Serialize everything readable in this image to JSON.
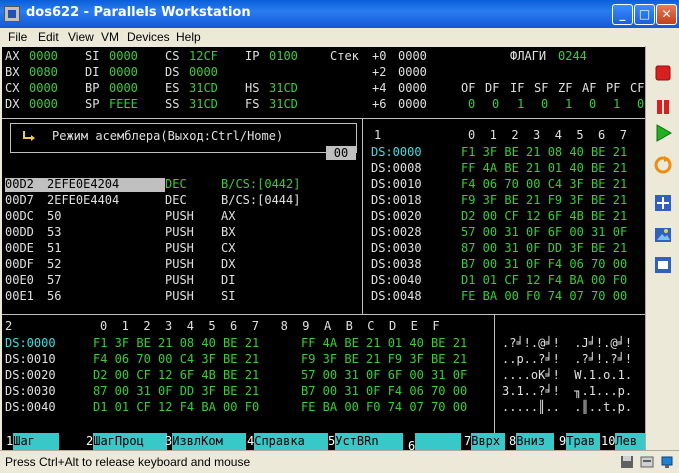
{
  "window": {
    "title": "dos622 - Parallels Workstation",
    "minimize": "_",
    "maximize": "□",
    "close": "✕"
  },
  "menu": [
    "File",
    "Edit",
    "View",
    "VM",
    "Devices",
    "Help"
  ],
  "registers": [
    [
      "AX",
      "0000",
      "SI",
      "0000",
      "CS",
      "12CF",
      "IP",
      "0100"
    ],
    [
      "BX",
      "0080",
      "DI",
      "0000",
      "DS",
      "0000",
      "",
      ""
    ],
    [
      "CX",
      "0000",
      "BP",
      "0000",
      "ES",
      "31CD",
      "HS",
      "31CD"
    ],
    [
      "DX",
      "0000",
      "SP",
      "FEEE",
      "SS",
      "31CD",
      "FS",
      "31CD"
    ]
  ],
  "stack": {
    "label": "Стек",
    "rows": [
      [
        "+0",
        "0000"
      ],
      [
        "+2",
        "0000"
      ],
      [
        "+4",
        "0000"
      ],
      [
        "+6",
        "0000"
      ]
    ]
  },
  "flags": {
    "label": "ФЛАГИ",
    "value": "0244",
    "names": [
      "OF",
      "DF",
      "IF",
      "SF",
      "ZF",
      "AF",
      "PF",
      "CF"
    ],
    "values": [
      "0",
      "0",
      "1",
      "0",
      "1",
      "0",
      "1",
      "0"
    ]
  },
  "assembler": {
    "prompt": "Режим асемблера(Выход:Ctrl/Home)",
    "indicator": "00"
  },
  "disasm": [
    {
      "addr": "00D2",
      "bytes": "2EFE0E4204",
      "mnem": "DEC",
      "op": "B/CS:[0442]"
    },
    {
      "addr": "00D7",
      "bytes": "2EFE0E4404",
      "mnem": "DEC",
      "op": "B/CS:[0444]"
    },
    {
      "addr": "00DC",
      "bytes": "50",
      "mnem": "PUSH",
      "op": "AX"
    },
    {
      "addr": "00DD",
      "bytes": "53",
      "mnem": "PUSH",
      "op": "BX"
    },
    {
      "addr": "00DE",
      "bytes": "51",
      "mnem": "PUSH",
      "op": "CX"
    },
    {
      "addr": "00DF",
      "bytes": "52",
      "mnem": "PUSH",
      "op": "DX"
    },
    {
      "addr": "00E0",
      "bytes": "57",
      "mnem": "PUSH",
      "op": "DI"
    },
    {
      "addr": "00E1",
      "bytes": "56",
      "mnem": "PUSH",
      "op": "SI"
    }
  ],
  "mem1": {
    "panel": "1",
    "cols": "0  1  2  3  4  5  6  7",
    "rows": [
      [
        "DS:0000",
        "F1 3F BE 21 08 40 BE 21"
      ],
      [
        "DS:0008",
        "FF 4A BE 21 01 40 BE 21"
      ],
      [
        "DS:0010",
        "F4 06 70 00 C4 3F BE 21"
      ],
      [
        "DS:0018",
        "F9 3F BE 21 F9 3F BE 21"
      ],
      [
        "DS:0020",
        "D2 00 CF 12 6F 4B BE 21"
      ],
      [
        "DS:0028",
        "57 00 31 0F 6F 00 31 0F"
      ],
      [
        "DS:0030",
        "87 00 31 0F DD 3F BE 21"
      ],
      [
        "DS:0038",
        "B7 00 31 0F F4 06 70 00"
      ],
      [
        "DS:0040",
        "D1 01 CF 12 F4 BA 00 F0"
      ],
      [
        "DS:0048",
        "FE BA 00 F0 74 07 70 00"
      ]
    ]
  },
  "mem2": {
    "panel": "2",
    "cols": "0  1  2  3  4  5  6  7   8  9  A  B  C  D  E  F",
    "rows": [
      [
        "DS:0000",
        "F1 3F BE 21 08 40 BE 21",
        "FF 4A BE 21 01 40 BE 21",
        ".?╛!.@╛!  .J╛!.@╛!"
      ],
      [
        "DS:0010",
        "F4 06 70 00 C4 3F BE 21",
        "F9 3F BE 21 F9 3F BE 21",
        "..p..?╛!  .?╛!.?╛!"
      ],
      [
        "DS:0020",
        "D2 00 CF 12 6F 4B BE 21",
        "57 00 31 0F 6F 00 31 0F",
        "....oK╛!  W.1.o.1."
      ],
      [
        "DS:0030",
        "87 00 31 0F DD 3F BE 21",
        "B7 00 31 0F F4 06 70 00",
        "З.1..?╛!  ╖.1...p."
      ],
      [
        "DS:0040",
        "D1 01 CF 12 F4 BA 00 F0",
        "FE BA 00 F0 74 07 70 00",
        ".....║..  .║..t.p."
      ]
    ]
  },
  "fkeys": [
    {
      "n": "1",
      "l": "Шаг"
    },
    {
      "n": "2",
      "l": "ШагПроц"
    },
    {
      "n": "3",
      "l": "ИзвлКом"
    },
    {
      "n": "4",
      "l": "Справка"
    },
    {
      "n": "5",
      "l": "УстBRn"
    },
    {
      "n": "6",
      "l": ""
    },
    {
      "n": "7",
      "l": "Вврх"
    },
    {
      "n": "8",
      "l": "Вниз"
    },
    {
      "n": "9",
      "l": "Трав"
    },
    {
      "n": "10",
      "l": "Лев"
    }
  ],
  "status": "Press Ctrl+Alt to release keyboard and mouse",
  "toolbar_icons": [
    "stop-icon",
    "pause-icon",
    "play-icon",
    "reset-icon",
    "fullscreen-icon",
    "screenshot-icon",
    "window-icon"
  ]
}
